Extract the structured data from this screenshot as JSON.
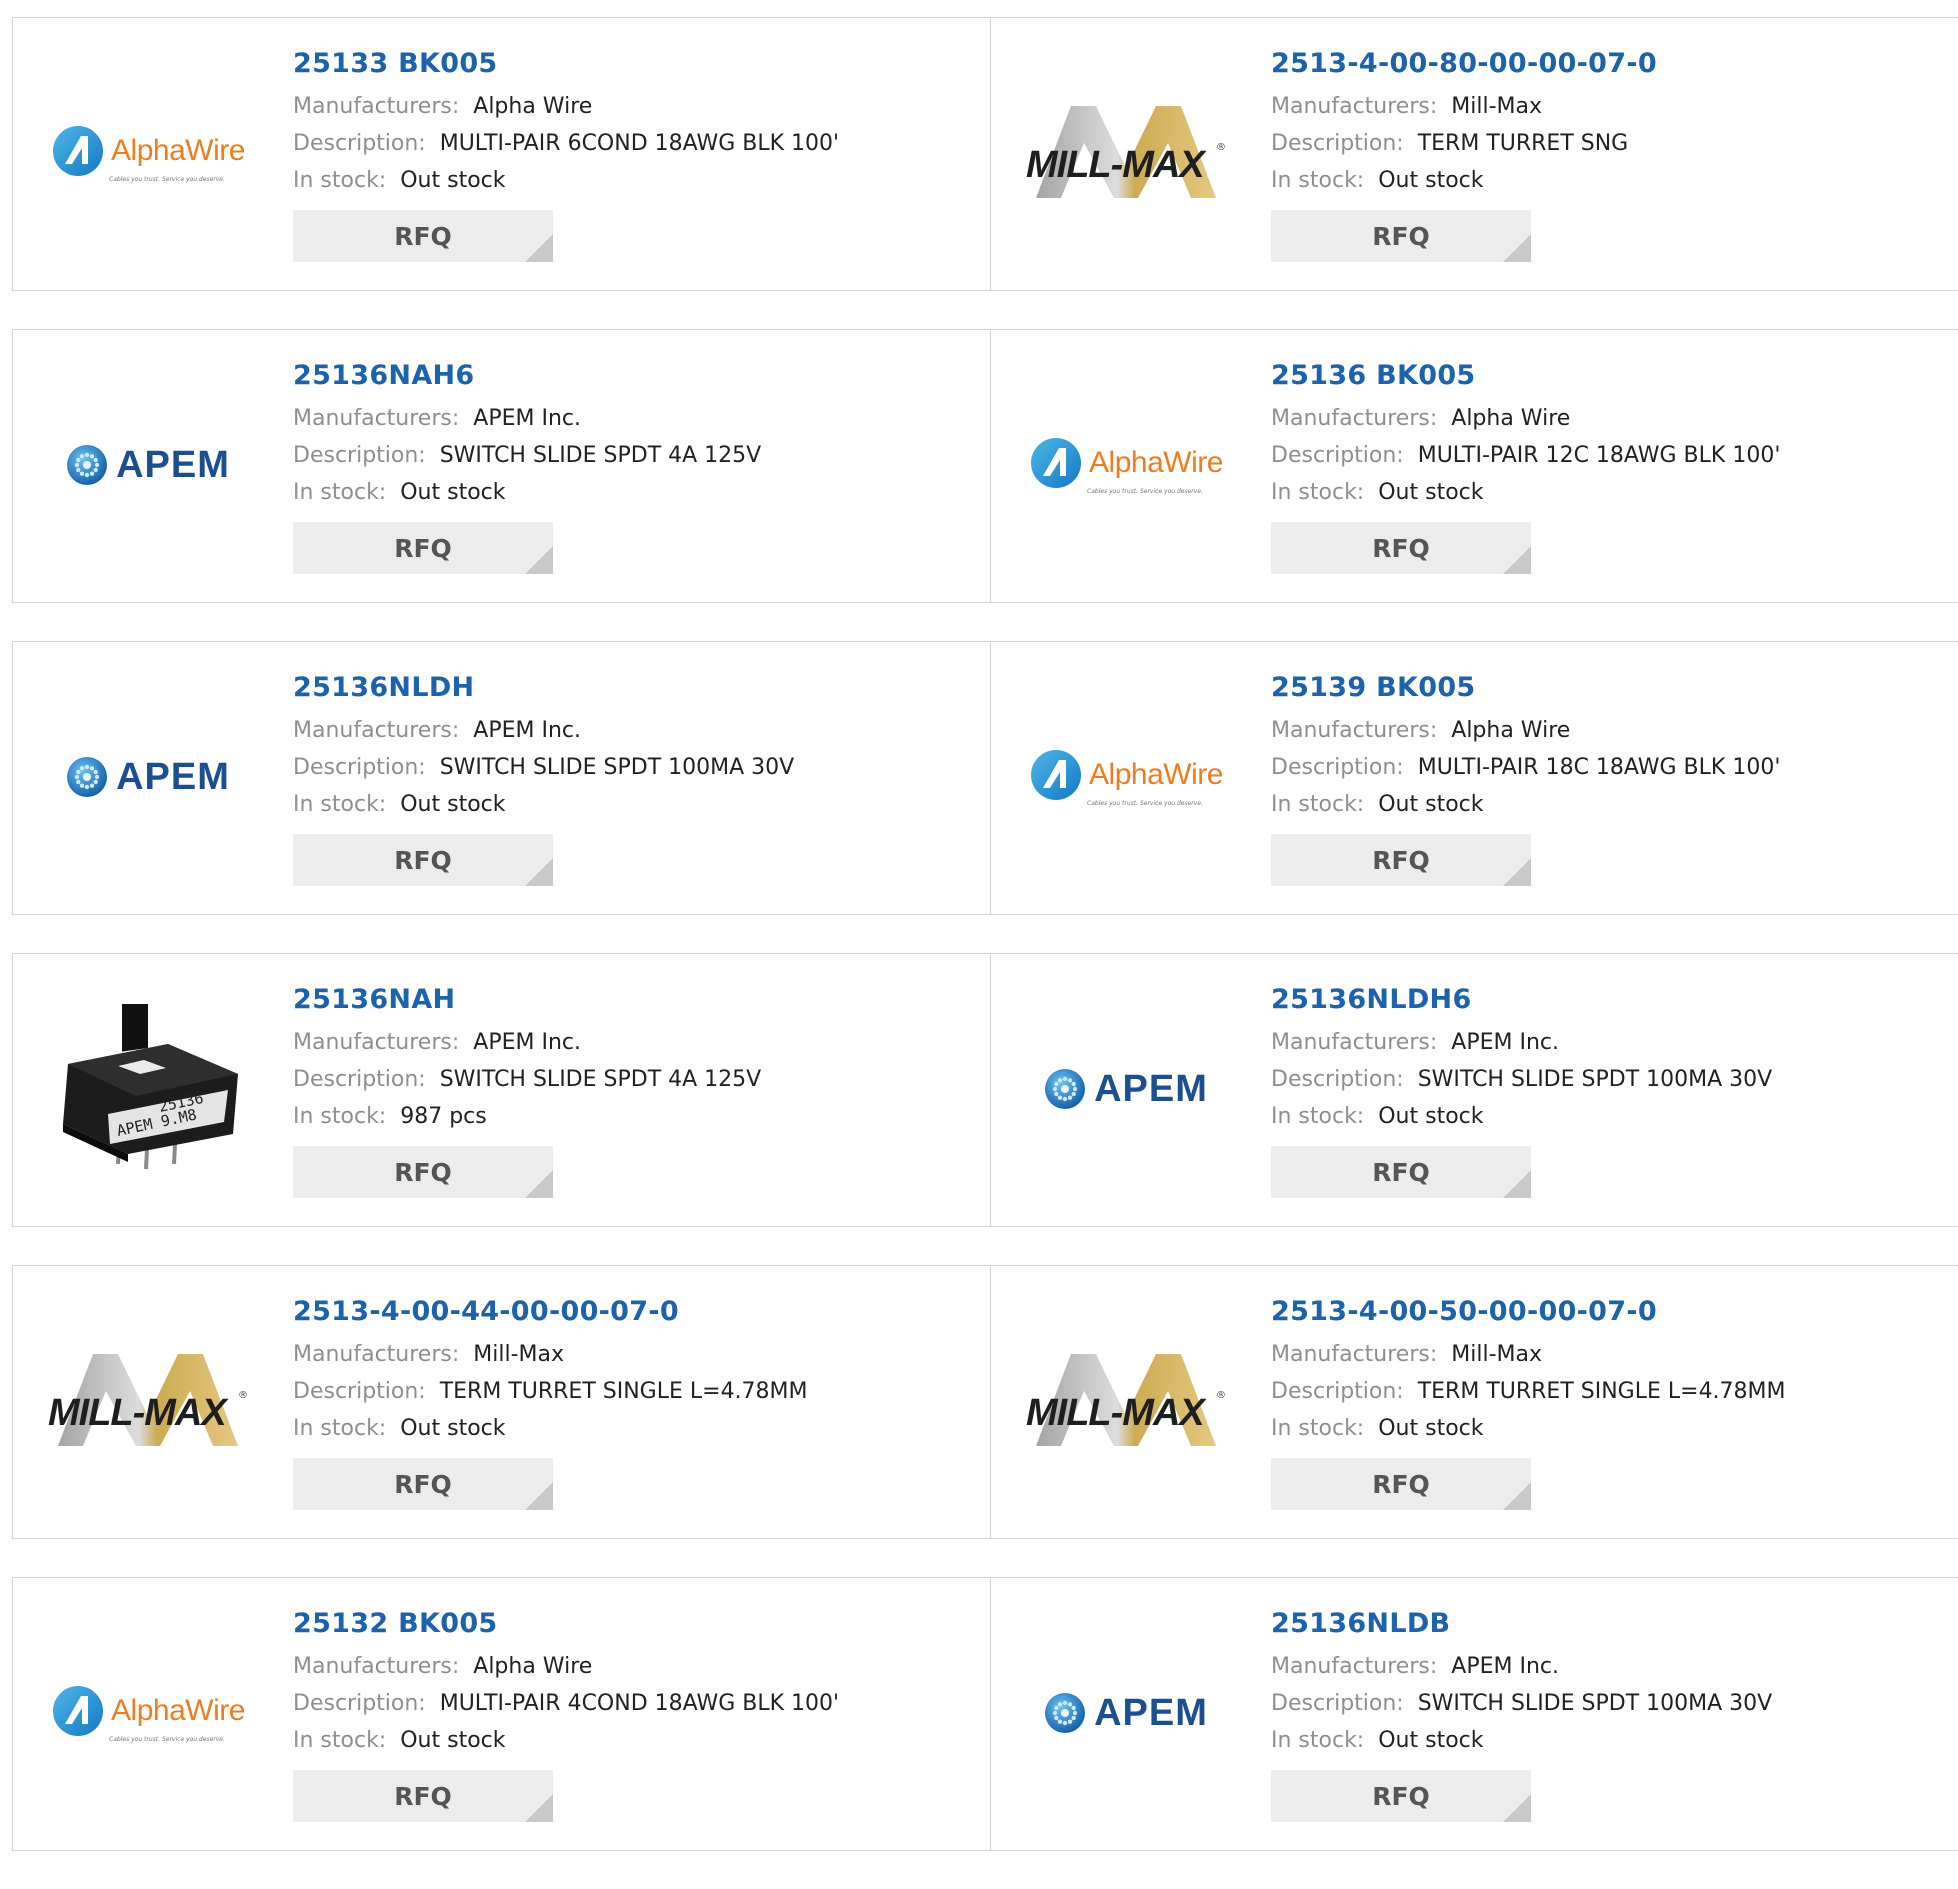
{
  "labels": {
    "manufacturers": "Manufacturers:",
    "description": "Description:",
    "in_stock": "In stock:",
    "rfq": "RFQ"
  },
  "logos": {
    "alphawire": {
      "text": "AlphaWire",
      "tagline": "Cables you trust. Service you deserve."
    },
    "apem": {
      "text": "APEM"
    },
    "millmax": {
      "text": "MILL-MAX",
      "reg": "®"
    },
    "part_photo": {
      "text1": "25136",
      "text2": "APEM 9.M8"
    }
  },
  "colors": {
    "link": "#1b63ad",
    "label": "#8f8f8f",
    "value": "#222222",
    "button_bg": "#ececec"
  },
  "products": [
    {
      "part": "25133 BK005",
      "manufacturer": "Alpha Wire",
      "description": "MULTI-PAIR 6COND 18AWG BLK 100'",
      "stock": "Out stock",
      "logo": "alphawire"
    },
    {
      "part": "2513-4-00-80-00-00-07-0",
      "manufacturer": "Mill-Max",
      "description": "TERM TURRET SNG",
      "stock": "Out stock",
      "logo": "millmax"
    },
    {
      "part": "25136NAH6",
      "manufacturer": "APEM Inc.",
      "description": "SWITCH SLIDE SPDT 4A 125V",
      "stock": "Out stock",
      "logo": "apem"
    },
    {
      "part": "25136 BK005",
      "manufacturer": "Alpha Wire",
      "description": "MULTI-PAIR 12C 18AWG BLK 100'",
      "stock": "Out stock",
      "logo": "alphawire"
    },
    {
      "part": "25136NLDH",
      "manufacturer": "APEM Inc.",
      "description": "SWITCH SLIDE SPDT 100MA 30V",
      "stock": "Out stock",
      "logo": "apem"
    },
    {
      "part": "25139 BK005",
      "manufacturer": "Alpha Wire",
      "description": "MULTI-PAIR 18C 18AWG BLK 100'",
      "stock": "Out stock",
      "logo": "alphawire"
    },
    {
      "part": "25136NAH",
      "manufacturer": "APEM Inc.",
      "description": "SWITCH SLIDE SPDT 4A 125V",
      "stock": "987 pcs",
      "logo": "part_photo"
    },
    {
      "part": "25136NLDH6",
      "manufacturer": "APEM Inc.",
      "description": "SWITCH SLIDE SPDT 100MA 30V",
      "stock": "Out stock",
      "logo": "apem"
    },
    {
      "part": "2513-4-00-44-00-00-07-0",
      "manufacturer": "Mill-Max",
      "description": "TERM TURRET SINGLE L=4.78MM",
      "stock": "Out stock",
      "logo": "millmax"
    },
    {
      "part": "2513-4-00-50-00-00-07-0",
      "manufacturer": "Mill-Max",
      "description": "TERM TURRET SINGLE L=4.78MM",
      "stock": "Out stock",
      "logo": "millmax"
    },
    {
      "part": "25132 BK005",
      "manufacturer": "Alpha Wire",
      "description": "MULTI-PAIR 4COND 18AWG BLK 100'",
      "stock": "Out stock",
      "logo": "alphawire"
    },
    {
      "part": "25136NLDB",
      "manufacturer": "APEM Inc.",
      "description": "SWITCH SLIDE SPDT 100MA 30V",
      "stock": "Out stock",
      "logo": "apem"
    }
  ]
}
